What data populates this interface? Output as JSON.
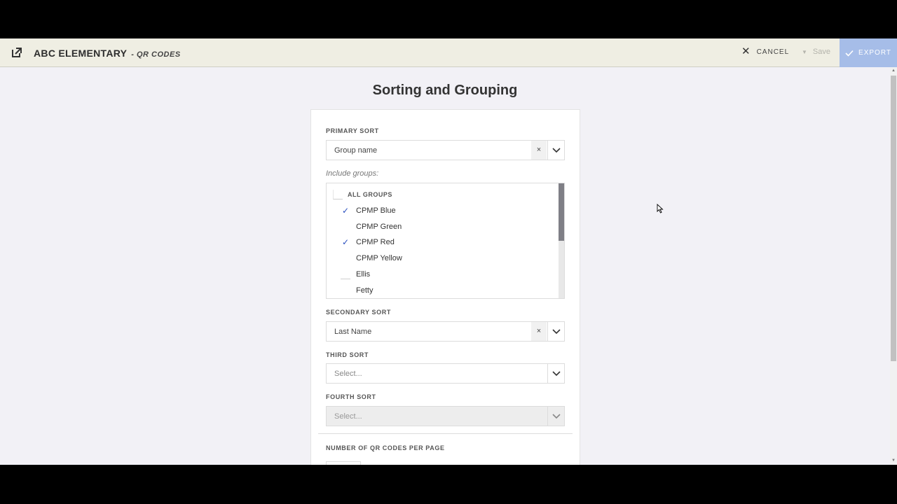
{
  "header": {
    "title": "ABC ELEMENTARY",
    "subtitle": "- QR CODES",
    "cancel_label": "CANCEL",
    "save_label": "Save",
    "export_label": "EXPORT"
  },
  "page": {
    "title": "Sorting and Grouping"
  },
  "primary_sort": {
    "label": "PRIMARY SORT",
    "value": "Group name",
    "clear": "×"
  },
  "include_groups": {
    "label": "Include groups:",
    "all_label": "ALL GROUPS",
    "items": [
      {
        "label": "CPMP Blue",
        "checked": true
      },
      {
        "label": "CPMP Green",
        "checked": false
      },
      {
        "label": "CPMP Red",
        "checked": true
      },
      {
        "label": "CPMP Yellow",
        "checked": false
      },
      {
        "label": "Ellis",
        "checked": false
      },
      {
        "label": "Fetty",
        "checked": false
      }
    ]
  },
  "secondary_sort": {
    "label": "SECONDARY SORT",
    "value": "Last Name",
    "clear": "×"
  },
  "third_sort": {
    "label": "THIRD SORT",
    "placeholder": "Select..."
  },
  "fourth_sort": {
    "label": "FOURTH SORT",
    "placeholder": "Select..."
  },
  "qr_per_page": {
    "label": "NUMBER OF QR CODES PER PAGE"
  },
  "colors": {
    "header_bg": "#efeee3",
    "export_bg": "#a6bde8",
    "check": "#2a4fbf",
    "content_bg": "#f2f1f6"
  }
}
